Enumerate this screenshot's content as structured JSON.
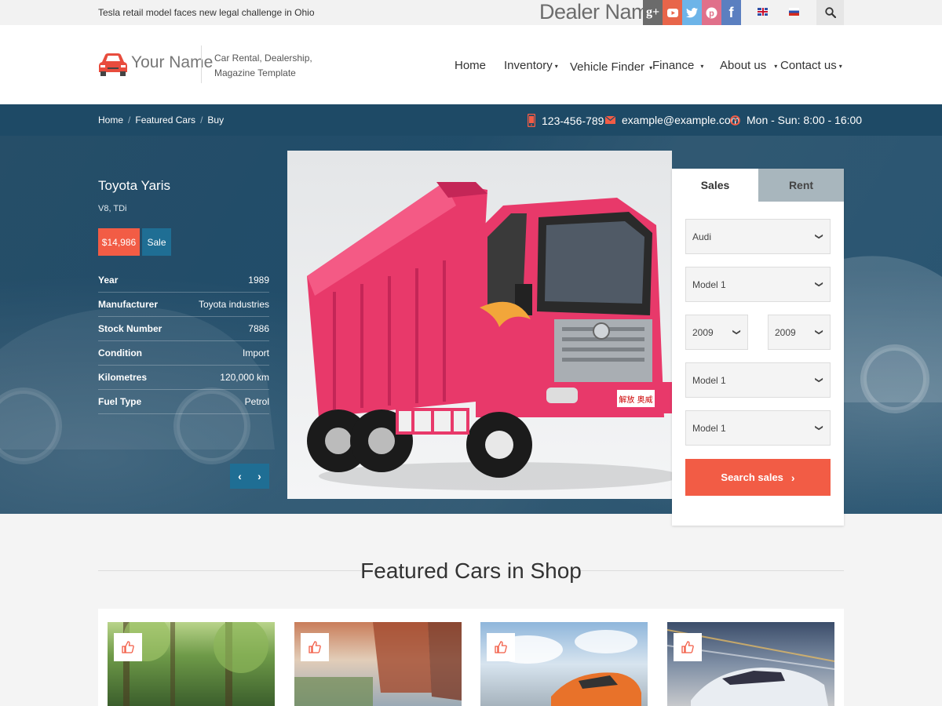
{
  "topbar": {
    "news": "Tesla retail model faces new legal challenge in Ohio",
    "dealer_name": "Dealer Name",
    "social": [
      "g+",
      "youtube-icon",
      "twitter-icon",
      "pinterest-icon",
      "f"
    ],
    "languages": [
      "en-flag",
      "ru-flag"
    ]
  },
  "header": {
    "logo_name": "Your Name",
    "tagline_1": "Car Rental, Dealership,",
    "tagline_2": "Magazine Template",
    "nav": {
      "home": "Home",
      "inventory": "Inventory",
      "vehicle_finder": "Vehicle Finder",
      "finance": "Finance",
      "about": "About us",
      "contact": "Contact us"
    }
  },
  "strip": {
    "crumbs": [
      "Home",
      "Featured Cars",
      "Buy"
    ],
    "phone": "123-456-789",
    "email": "example@example.com",
    "hours": "Mon - Sun: 8:00 - 16:00"
  },
  "hero": {
    "title": "Toyota Yaris",
    "subtitle": "V8, TDi",
    "price": "$14,986",
    "badge": "Sale",
    "specs": [
      {
        "k": "Year",
        "v": "1989"
      },
      {
        "k": "Manufacturer",
        "v": "Toyota industries"
      },
      {
        "k": "Stock Number",
        "v": "7886"
      },
      {
        "k": "Condition",
        "v": "Import"
      },
      {
        "k": "Kilometres",
        "v": "120,000 km"
      },
      {
        "k": "Fuel Type",
        "v": "Petrol"
      }
    ],
    "truck_plate": "解放 奥威"
  },
  "search": {
    "tab_sales": "Sales",
    "tab_rent": "Rent",
    "make": "Audi",
    "model_1": "Model 1",
    "year_from": "2009",
    "year_to": "2009",
    "model_2": "Model 1",
    "model_3": "Model 1",
    "button": "Search sales"
  },
  "featured": {
    "title": "Featured Cars in Shop"
  },
  "colors": {
    "accent": "#f25c45",
    "navy": "#1e4a66",
    "blue": "#1f6e94"
  }
}
